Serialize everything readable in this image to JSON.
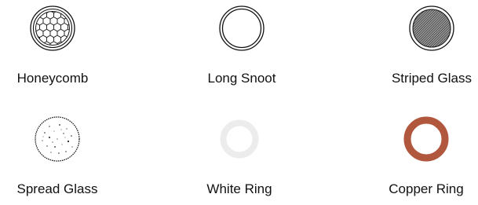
{
  "options": [
    {
      "id": "honeycomb",
      "label": "Honeycomb",
      "icon": "honeycomb-grid-icon"
    },
    {
      "id": "long-snoot",
      "label": "Long Snoot",
      "icon": "long-snoot-icon"
    },
    {
      "id": "striped-glass",
      "label": "Striped Glass",
      "icon": "striped-glass-icon"
    },
    {
      "id": "spread-glass",
      "label": "Spread Glass",
      "icon": "spread-glass-icon"
    },
    {
      "id": "white-ring",
      "label": "White Ring",
      "icon": "white-ring-icon",
      "color": "#ececec"
    },
    {
      "id": "copper-ring",
      "label": "Copper Ring",
      "icon": "copper-ring-icon",
      "color": "#b0573d"
    }
  ]
}
